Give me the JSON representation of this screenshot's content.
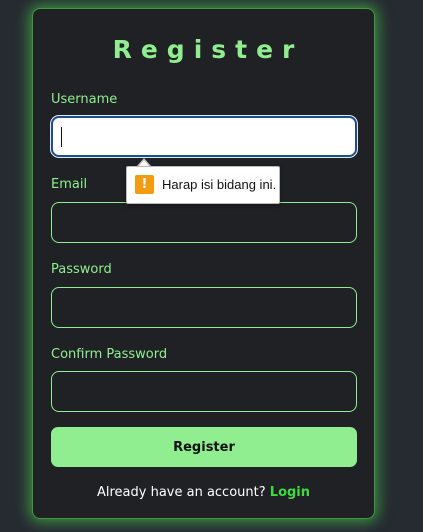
{
  "form": {
    "title": "Register",
    "fields": [
      {
        "label": "Username",
        "value": "",
        "placeholder": "",
        "focused": true
      },
      {
        "label": "Email",
        "value": "",
        "placeholder": ""
      },
      {
        "label": "Password",
        "value": "",
        "placeholder": ""
      },
      {
        "label": "Confirm Password",
        "value": "",
        "placeholder": ""
      }
    ],
    "submit_label": "Register",
    "footer_text": "Already have an account?",
    "login_link": "Login"
  },
  "validation_tooltip": {
    "icon": "warning-icon",
    "icon_glyph": "!",
    "message": "Harap isi bidang ini."
  },
  "colors": {
    "accent": "#90ee90",
    "link": "#3fdc3f",
    "background": "#262b32",
    "card": "#1f2125",
    "warning": "#f39c12"
  }
}
